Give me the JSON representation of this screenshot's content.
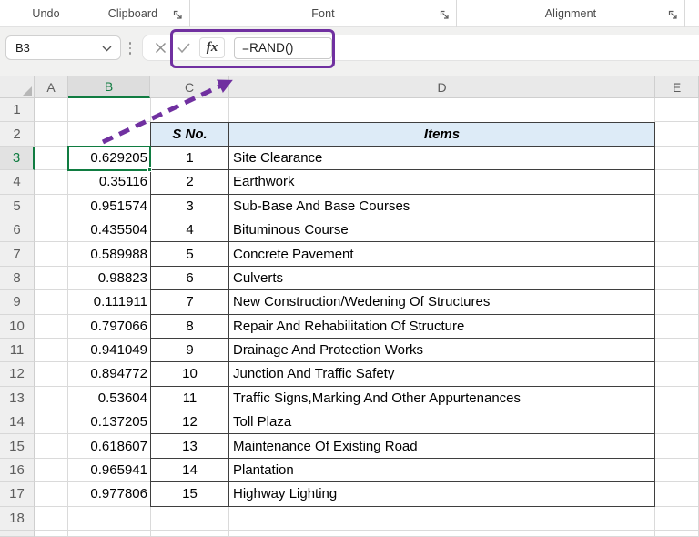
{
  "ribbon": {
    "groups": [
      {
        "label": "Undo",
        "launcher": false
      },
      {
        "label": "Clipboard",
        "launcher": true
      },
      {
        "label": "Font",
        "launcher": true
      },
      {
        "label": "Alignment",
        "launcher": true
      }
    ]
  },
  "formula_bar": {
    "name_box": "B3",
    "fx_label": "fx",
    "formula": "=RAND()"
  },
  "grid": {
    "column_letters": [
      "A",
      "B",
      "C",
      "D",
      "E"
    ],
    "row_numbers": [
      1,
      2,
      3,
      4,
      5,
      6,
      7,
      8,
      9,
      10,
      11,
      12,
      13,
      14,
      15,
      16,
      17,
      18
    ],
    "selected_cell": "B3",
    "selected_column": "B",
    "selected_row": 3
  },
  "table": {
    "sno_header": "S No.",
    "items_header": "Items",
    "rows": [
      {
        "sno": 1,
        "item": "Site Clearance",
        "rand": "0.629205"
      },
      {
        "sno": 2,
        "item": "Earthwork",
        "rand": "0.35116"
      },
      {
        "sno": 3,
        "item": "Sub-Base And Base Courses",
        "rand": "0.951574"
      },
      {
        "sno": 4,
        "item": "Bituminous Course",
        "rand": "0.435504"
      },
      {
        "sno": 5,
        "item": "Concrete Pavement",
        "rand": "0.589988"
      },
      {
        "sno": 6,
        "item": "Culverts",
        "rand": "0.98823"
      },
      {
        "sno": 7,
        "item": "New Construction/Wedening Of Structures",
        "rand": "0.111911"
      },
      {
        "sno": 8,
        "item": "Repair And Rehabilitation Of Structure",
        "rand": "0.797066"
      },
      {
        "sno": 9,
        "item": "Drainage And Protection Works",
        "rand": "0.941049"
      },
      {
        "sno": 10,
        "item": "Junction And Traffic Safety",
        "rand": "0.894772"
      },
      {
        "sno": 11,
        "item": "Traffic Signs,Marking And Other Appurtenances",
        "rand": "0.53604"
      },
      {
        "sno": 12,
        "item": "Toll Plaza",
        "rand": "0.137205"
      },
      {
        "sno": 13,
        "item": "Maintenance Of Existing Road",
        "rand": "0.618607"
      },
      {
        "sno": 14,
        "item": "Plantation",
        "rand": "0.965941"
      },
      {
        "sno": 15,
        "item": "Highway Lighting",
        "rand": "0.977806"
      }
    ]
  },
  "colors": {
    "accent_green": "#107C41",
    "annotation_purple": "#7030A0",
    "table_header_fill": "#DDEBF7"
  }
}
